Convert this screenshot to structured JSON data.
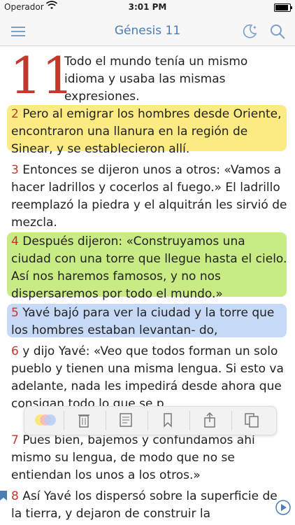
{
  "status": {
    "carrier": "Operador",
    "time": "3:01 PM"
  },
  "nav": {
    "title": "Génesis 11"
  },
  "chapter_number": "11",
  "verses": [
    {
      "num": "",
      "text": "Todo el mundo tenía un mismo idioma y usaba las mismas expresiones."
    },
    {
      "num": "2",
      "text": "Pero al emigrar los hombres desde Oriente, encontraron una llanura en la región de Sinear, y se establecieron allí."
    },
    {
      "num": "3",
      "text": "Entonces se dijeron unos a otros: «Vamos a hacer ladrillos y cocerlos al fuego.» El ladrillo reemplazó la piedra y el alquitrán les sirvió de mezcla."
    },
    {
      "num": "4",
      "text": "Después dijeron: «Construyamos una ciudad con una torre que llegue hasta el cielo. Así nos haremos famosos, y no nos dispersaremos por todo el mundo.»"
    },
    {
      "num": "5",
      "text": "Yavé bajó para ver la ciudad y la torre que los hombres estaban levantan- do,"
    },
    {
      "num": "6",
      "text": "y dijo Yavé: «Veo que todos forman un solo pueblo y tienen una misma lengua. Si esto va adelante, nada les impedirá desde ahora que consigan todo lo que se p"
    },
    {
      "num": "7",
      "text": "Pues bien, bajemos y confundamos ahí mismo su lengua, de modo que no se entiendan los unos a los otros.»"
    },
    {
      "num": "8",
      "text": "Así Yavé los dispersó sobre la superficie de la tierra, y dejaron de construir la"
    }
  ],
  "highlights": {
    "yellow": "#fbe45a",
    "green": "#b5e45a",
    "blue": "#b3cdf5"
  },
  "colors": {
    "verse_number": "#c0392b",
    "nav_tint": "#4b7db3"
  },
  "toolbar": {
    "buttons": [
      {
        "icon": "color-picker-icon"
      },
      {
        "icon": "trash-icon"
      },
      {
        "icon": "note-icon"
      },
      {
        "icon": "bookmark-icon"
      },
      {
        "icon": "share-icon"
      },
      {
        "icon": "copy-icon"
      }
    ]
  }
}
